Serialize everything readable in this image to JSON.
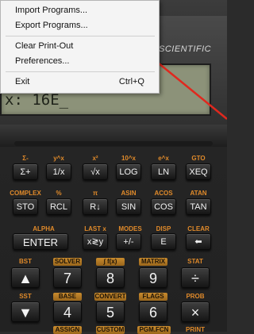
{
  "menu": {
    "items": [
      {
        "label": "Import Programs...",
        "accel": ""
      },
      {
        "label": "Export Programs...",
        "accel": ""
      },
      {
        "label": "Clear Print-Out",
        "accel": ""
      },
      {
        "label": "Preferences...",
        "accel": ""
      },
      {
        "label": "Exit",
        "accel": "Ctrl+Q"
      }
    ]
  },
  "calculator": {
    "brand": "SCIENTIFIC",
    "display": {
      "x_line": "x: 16E_"
    },
    "rows": [
      {
        "shift": [
          "Σ-",
          "y^x",
          "x²",
          "10^x",
          "e^x",
          "GTO"
        ],
        "keys": [
          "Σ+",
          "1/x",
          "√x",
          "LOG",
          "LN",
          "XEQ"
        ]
      },
      {
        "shift": [
          "COMPLEX",
          "%",
          "π",
          "ASIN",
          "ACOS",
          "ATAN"
        ],
        "keys": [
          "STO",
          "RCL",
          "R↓",
          "SIN",
          "COS",
          "TAN"
        ]
      },
      {
        "shift": [
          "ALPHA",
          "LAST x",
          "MODES",
          "DISP",
          "CLEAR"
        ],
        "keys": [
          "ENTER",
          "x≷y",
          "+/-",
          "E",
          "⬅"
        ]
      },
      {
        "shift": [
          "BST",
          "SOLVER",
          "∫ f(x)",
          "MATRIX",
          "STAT"
        ],
        "keys": [
          "▲",
          "7",
          "8",
          "9",
          "÷"
        ]
      },
      {
        "shift": [
          "SST",
          "BASE",
          "CONVERT",
          "FLAGS",
          "PROB"
        ],
        "keys": [
          "▼",
          "4",
          "5",
          "6",
          "×"
        ]
      },
      {
        "shift": [
          "ASSIGN",
          "CUSTOM",
          "PGM.FCN",
          "PRINT"
        ],
        "keys": []
      }
    ]
  },
  "colors": {
    "shift_label": "#e08a2a",
    "annotation_arrow": "#e0281e",
    "lcd": "#8c9279"
  }
}
